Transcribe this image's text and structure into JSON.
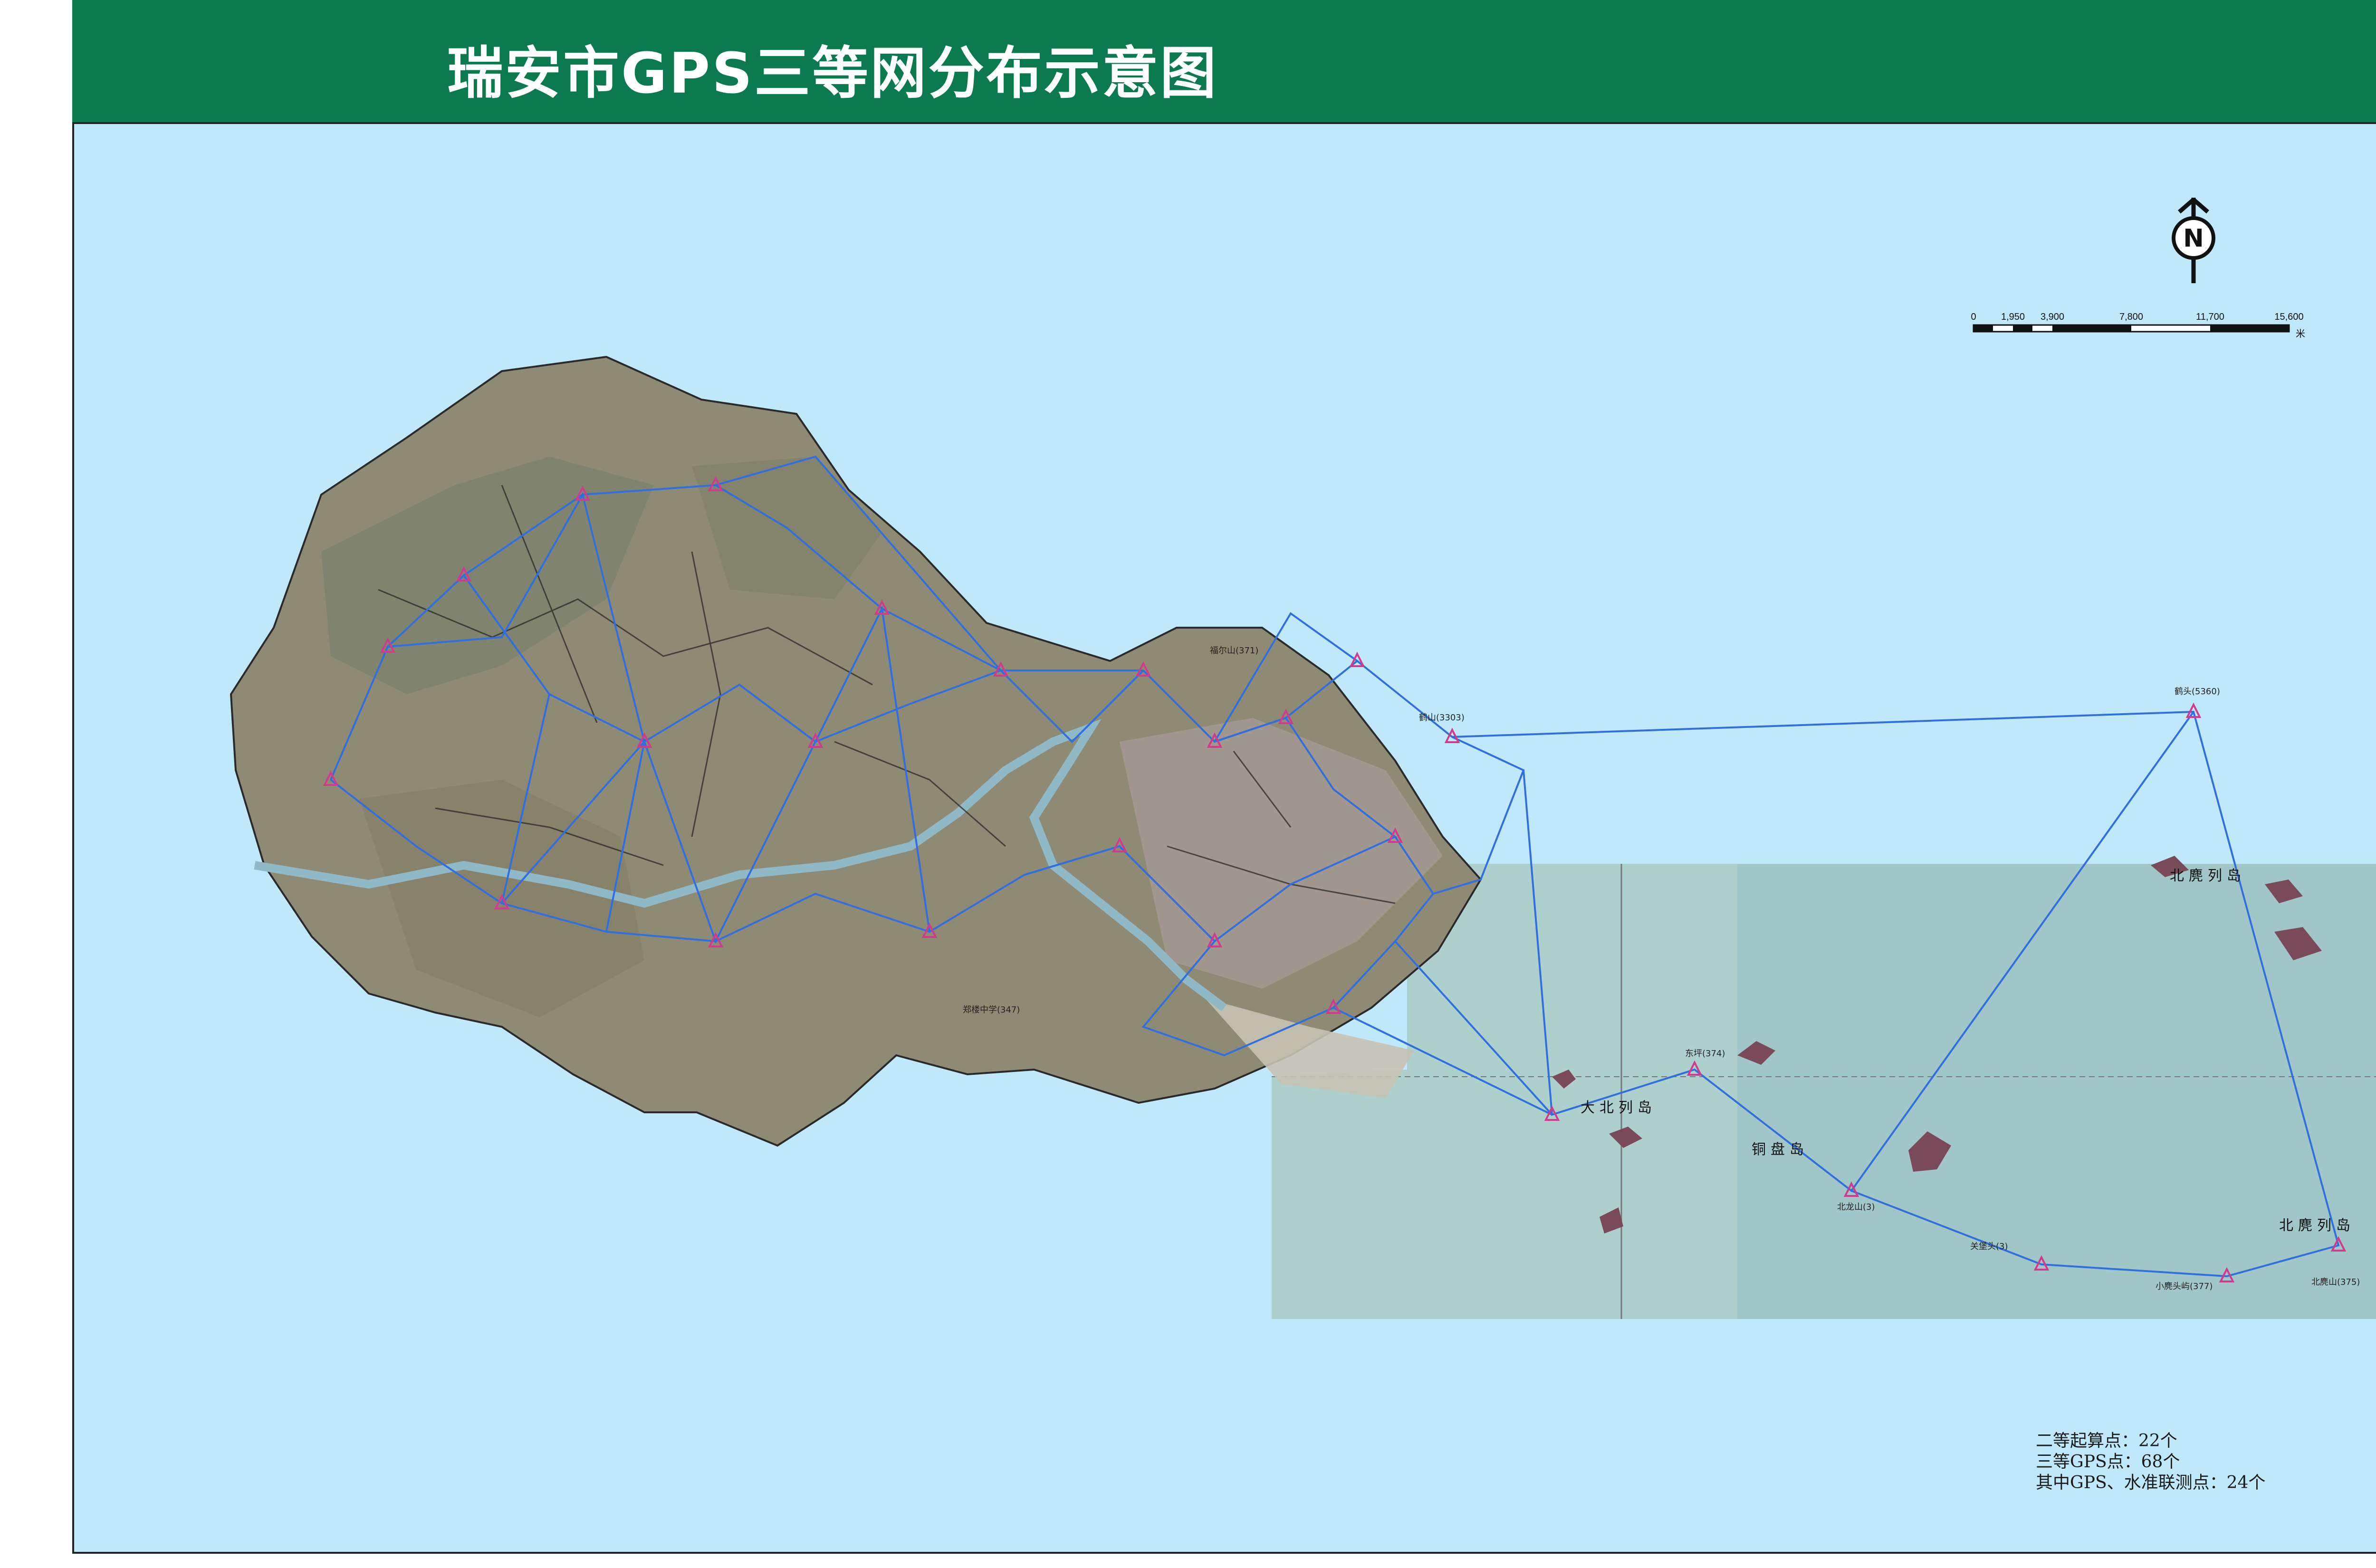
{
  "title": "瑞安市GPS三等网分布示意图",
  "colors": {
    "title_bg": "#0b7a4f",
    "sea": "#bfe8fb",
    "land": "#8f8a74",
    "network_line": "#2f6fe0",
    "point": "#d23a8c",
    "satellite_sea": "#9fc4c4"
  },
  "north_arrow": {
    "label": "N",
    "icon": "north-arrow-icon"
  },
  "scale_bar": {
    "ticks": [
      "0",
      "1,950",
      "3,900",
      "7,800",
      "11,700",
      "15,600"
    ],
    "unit": "米"
  },
  "legend": [
    "二等起算点：22个",
    "三等GPS点：68个",
    "其中GPS、水准联测点：24个"
  ],
  "region_labels": [
    "北麂列岛",
    "大北列岛",
    "铜盘岛",
    "北麂列岛"
  ],
  "station_labels": [
    "福尔山(371)",
    "鹤头(5360)",
    "鹤山(3303)",
    "郑楼中学(347)",
    "北龙山(3)",
    "关堡头(3)",
    "小麂头屿(377)",
    "北麂山(375)",
    "东坪(374)"
  ]
}
